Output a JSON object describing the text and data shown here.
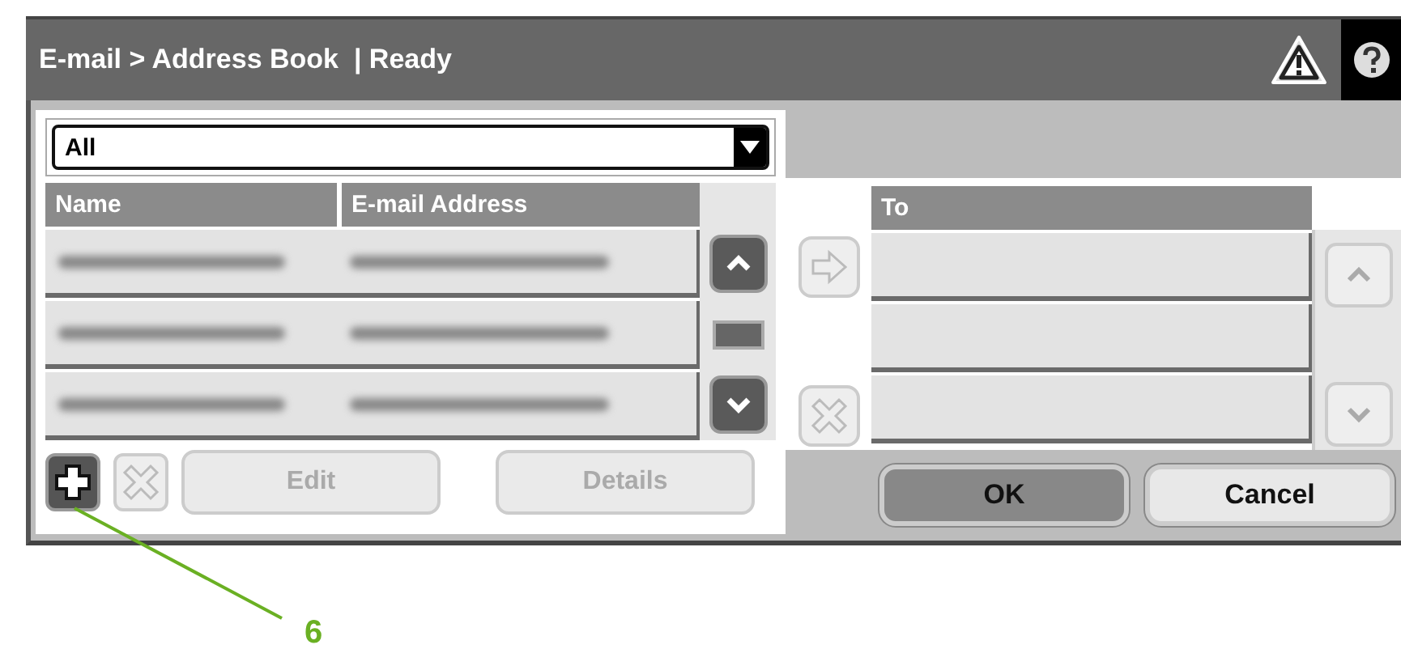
{
  "window": {
    "title": "E-mail > Address Book  | Ready"
  },
  "filter": {
    "value": "All"
  },
  "address_list": {
    "columns": [
      "Name",
      "E-mail Address"
    ],
    "rows": [
      {
        "kind": "blurred"
      },
      {
        "kind": "blurred"
      },
      {
        "kind": "blurred"
      }
    ],
    "scroll_up": {
      "disabled": false
    },
    "scroll_down": {
      "disabled": false
    }
  },
  "list_buttons": [
    {
      "kind": "add",
      "disabled": false
    },
    {
      "kind": "delete",
      "disabled": true
    },
    {
      "kind": "text",
      "label": "Edit",
      "disabled": true
    },
    {
      "kind": "text",
      "label": "Details",
      "disabled": true
    }
  ],
  "move_buttons": [
    {
      "kind": "add-arrow",
      "disabled": true
    },
    {
      "kind": "remove",
      "disabled": true
    }
  ],
  "to_list": {
    "columns": [
      "To"
    ],
    "rows": [
      {
        "kind": "empty"
      },
      {
        "kind": "empty"
      },
      {
        "kind": "empty"
      }
    ],
    "scroll_up": {
      "disabled": true
    },
    "scroll_down": {
      "disabled": true
    }
  },
  "dialog_buttons": [
    {
      "label": "OK",
      "selected": true
    },
    {
      "label": "Cancel",
      "selected": false
    }
  ],
  "callout": {
    "label": "6"
  }
}
